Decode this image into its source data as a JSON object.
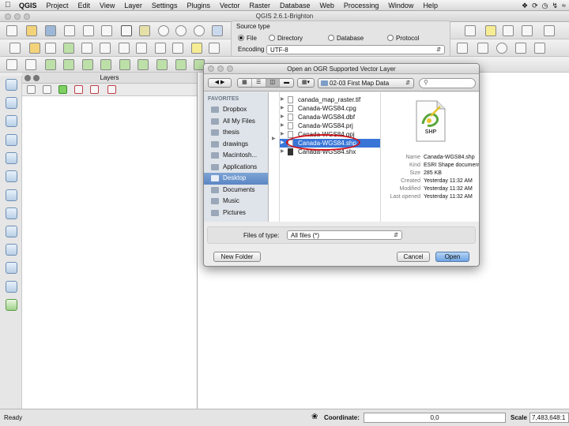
{
  "menubar": {
    "apple": "",
    "items": [
      "QGIS",
      "Project",
      "Edit",
      "View",
      "Layer",
      "Settings",
      "Plugins",
      "Vector",
      "Raster",
      "Database",
      "Web",
      "Processing",
      "Window",
      "Help"
    ]
  },
  "window": {
    "title": "QGIS 2.6.1-Brighton"
  },
  "source_type": {
    "label": "Source type",
    "options": [
      "File",
      "Directory",
      "Database",
      "Protocol"
    ],
    "selected": "File",
    "encoding_label": "Encoding",
    "encoding_value": "UTF-8"
  },
  "layers_panel": {
    "title": "Layers"
  },
  "map_partial_text": "ng",
  "dialog": {
    "title": "Open an OGR Supported Vector Layer",
    "path": "02-03 First Map Data",
    "search_placeholder": "",
    "favorites_label": "FAVORITES",
    "favorites": [
      "Dropbox",
      "All My Files",
      "thesis",
      "drawings",
      "Macintosh...",
      "Applications",
      "Desktop",
      "Documents",
      "Music",
      "Pictures"
    ],
    "selected_favorite": "Desktop",
    "files": [
      "canada_map_raster.tif",
      "Canada-WGS84.cpg",
      "Canada-WGS84.dbf",
      "Canada-WGS84.prj",
      "Canada-WGS84.qpj",
      "Canada-WGS84.shp",
      "Canada-WGS84.shx"
    ],
    "selected_file": "Canada-WGS84.shp",
    "preview": {
      "icon_label": "SHP",
      "info": [
        {
          "key": "Name",
          "value": "Canada-WGS84.shp"
        },
        {
          "key": "Kind",
          "value": "ESRI Shape document"
        },
        {
          "key": "Size",
          "value": "285 KB"
        },
        {
          "key": "Created",
          "value": "Yesterday 11:32 AM"
        },
        {
          "key": "Modified",
          "value": "Yesterday 11:32 AM"
        },
        {
          "key": "Last opened",
          "value": "Yesterday 11:32 AM"
        }
      ]
    },
    "files_of_type_label": "Files of type:",
    "files_of_type_value": "All files (*)",
    "new_folder_label": "New Folder",
    "cancel_label": "Cancel",
    "open_label": "Open"
  },
  "status": {
    "ready": "Ready",
    "coordinate_label": "Coordinate:",
    "coordinate_value": "0,0",
    "scale_label": "Scale",
    "scale_value": "7,483,648:1"
  },
  "colors": {
    "selection": "#3875d7",
    "annotation_circle": "#d1121b",
    "primary_button": "#6fa4e2"
  }
}
